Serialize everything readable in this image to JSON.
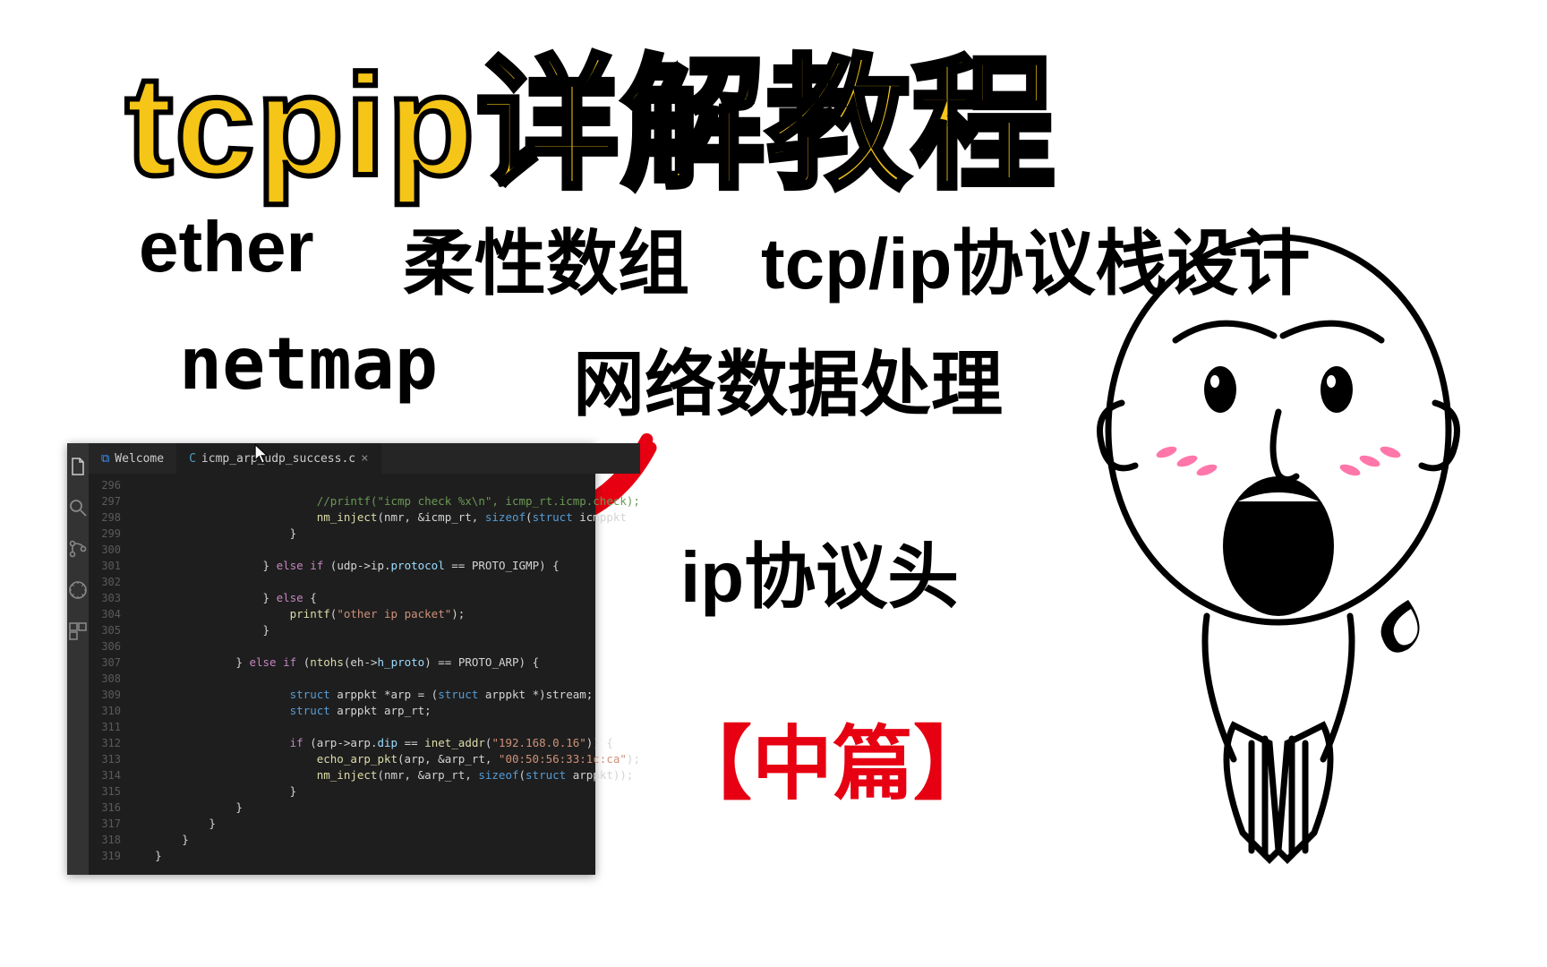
{
  "title": "tcpip详解教程",
  "keywords": {
    "k1": "ether",
    "k2": "柔性数组",
    "k3": "tcp/ip协议栈设计",
    "k4": "netmap",
    "k5": "网络数据处理",
    "k6": "ip协议头"
  },
  "part_label": "【中篇】",
  "editor": {
    "tabs": {
      "welcome": "Welcome",
      "file": "icmp_arp_udp_success.c"
    },
    "line_start": 296,
    "line_end": 319,
    "code_lines": [
      {
        "indent": 28,
        "segs": [
          {
            "cls": "c-cm",
            "txt": ""
          }
        ]
      },
      {
        "indent": 28,
        "segs": [
          {
            "cls": "c-cm",
            "txt": "//printf(\"icmp check %x\\n\", icmp_rt.icmp.check);"
          }
        ]
      },
      {
        "indent": 28,
        "segs": [
          {
            "cls": "c-fn",
            "txt": "nm_inject"
          },
          {
            "cls": "",
            "txt": "(nmr, &icmp_rt, "
          },
          {
            "cls": "c-ty",
            "txt": "sizeof"
          },
          {
            "cls": "",
            "txt": "("
          },
          {
            "cls": "c-ty",
            "txt": "struct"
          },
          {
            "cls": "",
            "txt": " icmppkt"
          }
        ]
      },
      {
        "indent": 24,
        "segs": [
          {
            "cls": "",
            "txt": "}"
          }
        ]
      },
      {
        "indent": 0,
        "segs": [
          {
            "cls": "",
            "txt": ""
          }
        ]
      },
      {
        "indent": 20,
        "segs": [
          {
            "cls": "",
            "txt": "} "
          },
          {
            "cls": "c-kw",
            "txt": "else if"
          },
          {
            "cls": "",
            "txt": " (udp->ip."
          },
          {
            "cls": "c-pl",
            "txt": "protocol"
          },
          {
            "cls": "",
            "txt": " == PROTO_IGMP) {"
          }
        ]
      },
      {
        "indent": 0,
        "segs": [
          {
            "cls": "",
            "txt": ""
          }
        ]
      },
      {
        "indent": 20,
        "segs": [
          {
            "cls": "",
            "txt": "} "
          },
          {
            "cls": "c-kw",
            "txt": "else"
          },
          {
            "cls": "",
            "txt": " {"
          }
        ]
      },
      {
        "indent": 24,
        "segs": [
          {
            "cls": "c-fn",
            "txt": "printf"
          },
          {
            "cls": "",
            "txt": "("
          },
          {
            "cls": "c-str",
            "txt": "\"other ip packet\""
          },
          {
            "cls": "",
            "txt": ");"
          }
        ]
      },
      {
        "indent": 20,
        "segs": [
          {
            "cls": "",
            "txt": "}"
          }
        ]
      },
      {
        "indent": 0,
        "segs": [
          {
            "cls": "",
            "txt": ""
          }
        ]
      },
      {
        "indent": 16,
        "segs": [
          {
            "cls": "",
            "txt": "} "
          },
          {
            "cls": "c-kw",
            "txt": "else if"
          },
          {
            "cls": "",
            "txt": " ("
          },
          {
            "cls": "c-fn",
            "txt": "ntohs"
          },
          {
            "cls": "",
            "txt": "(eh->"
          },
          {
            "cls": "c-pl",
            "txt": "h_proto"
          },
          {
            "cls": "",
            "txt": ") == PROTO_ARP) {"
          }
        ]
      },
      {
        "indent": 0,
        "segs": [
          {
            "cls": "",
            "txt": ""
          }
        ]
      },
      {
        "indent": 24,
        "segs": [
          {
            "cls": "c-ty",
            "txt": "struct"
          },
          {
            "cls": "",
            "txt": " arppkt *arp = ("
          },
          {
            "cls": "c-ty",
            "txt": "struct"
          },
          {
            "cls": "",
            "txt": " arppkt *)stream;"
          }
        ]
      },
      {
        "indent": 24,
        "segs": [
          {
            "cls": "c-ty",
            "txt": "struct"
          },
          {
            "cls": "",
            "txt": " arppkt arp_rt;"
          }
        ]
      },
      {
        "indent": 0,
        "segs": [
          {
            "cls": "",
            "txt": ""
          }
        ]
      },
      {
        "indent": 24,
        "segs": [
          {
            "cls": "c-kw",
            "txt": "if"
          },
          {
            "cls": "",
            "txt": " (arp->arp."
          },
          {
            "cls": "c-pl",
            "txt": "dip"
          },
          {
            "cls": "",
            "txt": " == "
          },
          {
            "cls": "c-fn",
            "txt": "inet_addr"
          },
          {
            "cls": "",
            "txt": "("
          },
          {
            "cls": "c-str",
            "txt": "\"192.168.0.16\""
          },
          {
            "cls": "",
            "txt": ")) {"
          }
        ]
      },
      {
        "indent": 28,
        "segs": [
          {
            "cls": "c-fn",
            "txt": "echo_arp_pkt"
          },
          {
            "cls": "",
            "txt": "(arp, &arp_rt, "
          },
          {
            "cls": "c-str",
            "txt": "\"00:50:56:33:1c:ca\""
          },
          {
            "cls": "",
            "txt": ");"
          }
        ]
      },
      {
        "indent": 28,
        "segs": [
          {
            "cls": "c-fn",
            "txt": "nm_inject"
          },
          {
            "cls": "",
            "txt": "(nmr, &arp_rt, "
          },
          {
            "cls": "c-ty",
            "txt": "sizeof"
          },
          {
            "cls": "",
            "txt": "("
          },
          {
            "cls": "c-ty",
            "txt": "struct"
          },
          {
            "cls": "",
            "txt": " arppkt));"
          }
        ]
      },
      {
        "indent": 24,
        "segs": [
          {
            "cls": "",
            "txt": "}"
          }
        ]
      },
      {
        "indent": 16,
        "segs": [
          {
            "cls": "",
            "txt": "}"
          }
        ]
      },
      {
        "indent": 12,
        "segs": [
          {
            "cls": "",
            "txt": "}"
          }
        ]
      },
      {
        "indent": 8,
        "segs": [
          {
            "cls": "",
            "txt": "}"
          }
        ]
      },
      {
        "indent": 4,
        "segs": [
          {
            "cls": "",
            "txt": "}"
          }
        ]
      }
    ]
  }
}
